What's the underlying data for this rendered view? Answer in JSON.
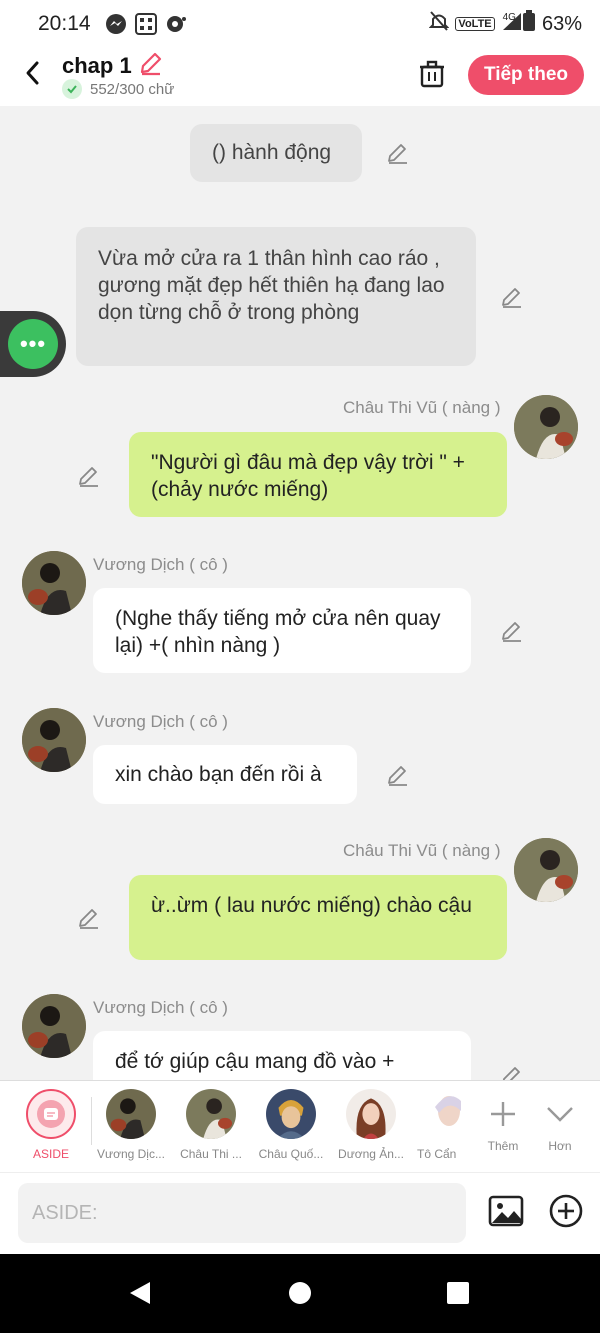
{
  "status_bar": {
    "time": "20:14",
    "network": "VoLTE",
    "signal": "4G",
    "battery": "63%"
  },
  "header": {
    "title": "chap 1",
    "word_count": "552/300 chữ",
    "next_label": "Tiếp theo"
  },
  "messages": [
    {
      "type": "action",
      "text": "() hành động"
    },
    {
      "type": "narration",
      "text": "Vừa mở cửa ra 1 thân hình cao ráo , gương mặt đẹp hết thiên hạ đang lao dọn từng chỗ ở trong phòng"
    },
    {
      "type": "right",
      "name": "Châu Thi Vũ ( nàng )",
      "text": "\"Người gì đâu mà đẹp vậy trời \" + (chảy nước miếng)"
    },
    {
      "type": "left",
      "name": "Vương Dịch ( cô )",
      "text": "(Nghe thấy tiếng mở cửa nên quay lại) +(  nhìn nàng )"
    },
    {
      "type": "left",
      "name": "Vương Dịch ( cô )",
      "text": "xin chào bạn đến rồi à"
    },
    {
      "type": "right",
      "name": "Châu Thi Vũ ( nàng )",
      "text": "ừ..ừm ( lau nước miếng) chào cậu"
    },
    {
      "type": "left",
      "name": "Vương Dịch ( cô )",
      "text": "để tớ giúp cậu mang đồ vào +"
    }
  ],
  "characters": [
    {
      "label": "ASIDE"
    },
    {
      "label": "Vương Dịc..."
    },
    {
      "label": "Châu Thi ..."
    },
    {
      "label": "Châu Quố..."
    },
    {
      "label": "Dương Ản..."
    },
    {
      "label": "Tô Cẩn"
    },
    {
      "label": "Thêm"
    },
    {
      "label": "Hơn"
    }
  ],
  "input": {
    "placeholder": "ASIDE:"
  },
  "colors": {
    "accent": "#ef4e6a",
    "green_bubble": "#d6f18e",
    "floating": "#3cc060"
  }
}
